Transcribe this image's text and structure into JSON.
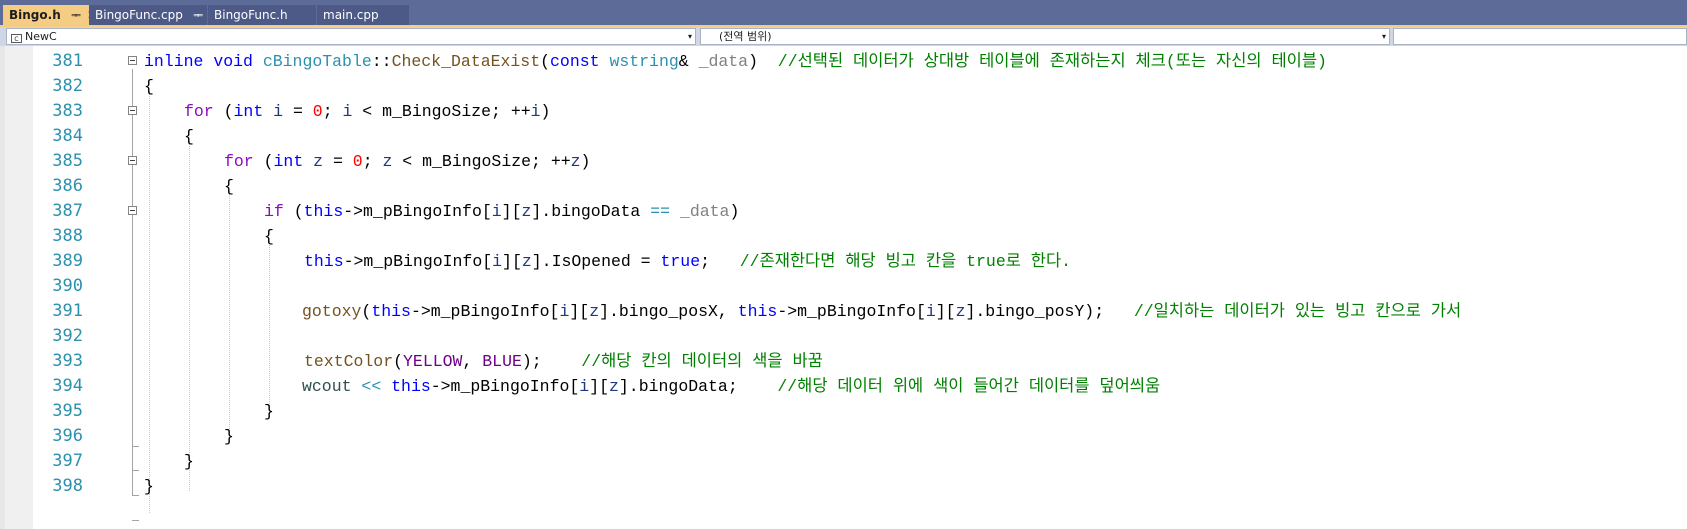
{
  "tabs": [
    {
      "label": "Bingo.h",
      "pin": "ᆍ",
      "close": "✕",
      "active": true
    },
    {
      "label": "BingoFunc.cpp",
      "pin": "ᆍ",
      "active": false
    },
    {
      "label": "BingoFunc.h",
      "active": false
    },
    {
      "label": "main.cpp",
      "active": false
    }
  ],
  "nav": {
    "project": "NewC",
    "scope": "(전역 범위)",
    "dropdown_glyph": "▾"
  },
  "editor": {
    "line_numbers": [
      "381",
      "382",
      "383",
      "384",
      "385",
      "386",
      "387",
      "388",
      "389",
      "390",
      "391",
      "392",
      "393",
      "394",
      "395",
      "396",
      "397",
      "398"
    ]
  },
  "code": {
    "l381": {
      "t1": "inline",
      "t2": " ",
      "t3": "void",
      "t4": " ",
      "t5": "cBingoTable",
      "t6": "::",
      "t7": "Check_DataExist",
      "t8": "(",
      "t9": "const",
      "t10": " ",
      "t11": "wstring",
      "t12": "& ",
      "t13": "_data",
      "t14": ")  ",
      "t15": "//선택된 데이터가 상대방 테이블에 존재하는지 체크(또는 자신의 테이블)"
    },
    "l382": {
      "t1": "{"
    },
    "l383": {
      "t1": "for",
      "t2": " (",
      "t3": "int",
      "t4": " ",
      "t5": "i",
      "t6": " = ",
      "t7": "0",
      "t8": "; ",
      "t9": "i",
      "t10": " < m_BingoSize; ++",
      "t11": "i",
      "t12": ")"
    },
    "l384": {
      "t1": "{"
    },
    "l385": {
      "t1": "for",
      "t2": " (",
      "t3": "int",
      "t4": " ",
      "t5": "z",
      "t6": " = ",
      "t7": "0",
      "t8": "; ",
      "t9": "z",
      "t10": " < m_BingoSize; ++",
      "t11": "z",
      "t12": ")"
    },
    "l386": {
      "t1": "{"
    },
    "l387": {
      "t1": "if",
      "t2": " (",
      "t3": "this",
      "t4": "->m_pBingoInfo[",
      "t5": "i",
      "t6": "][",
      "t7": "z",
      "t8": "].bingoData ",
      "t9": "==",
      "t10": " ",
      "t11": "_data",
      "t12": ")"
    },
    "l388": {
      "t1": "{"
    },
    "l389": {
      "t1": "this",
      "t2": "->m_pBingoInfo[",
      "t3": "i",
      "t4": "][",
      "t5": "z",
      "t6": "].IsOpened = ",
      "t7": "true",
      "t8": ";   ",
      "t9": "//존재한다면 해당 빙고 칸을 true로 한다."
    },
    "l391": {
      "t1": "gotoxy",
      "t2": "(",
      "t3": "this",
      "t4": "->m_pBingoInfo[",
      "t5": "i",
      "t6": "][",
      "t7": "z",
      "t8": "].bingo_posX, ",
      "t9": "this",
      "t10": "->m_pBingoInfo[",
      "t11": "i",
      "t12": "][",
      "t13": "z",
      "t14": "].bingo_posY);   ",
      "t15": "//일치하는 데이터가 있는 빙고 칸으로 가서"
    },
    "l393": {
      "t1": "textColor",
      "t2": "(",
      "t3": "YELLOW",
      "t4": ", ",
      "t5": "BLUE",
      "t6": ");    ",
      "t7": "//해당 칸의 데이터의 색을 바꿈"
    },
    "l394": {
      "t1": "wcout",
      "t2": " ",
      "t3": "<<",
      "t4": " ",
      "t5": "this",
      "t6": "->m_pBingoInfo[",
      "t7": "i",
      "t8": "][",
      "t9": "z",
      "t10": "].bingoData;    ",
      "t11": "//해당 데이터 위에 색이 들어간 데이터를 덮어씌움"
    },
    "l395": {
      "t1": "}"
    },
    "l396": {
      "t1": "}"
    },
    "l397": {
      "t1": "}"
    },
    "l398": {
      "t1": "}"
    }
  }
}
